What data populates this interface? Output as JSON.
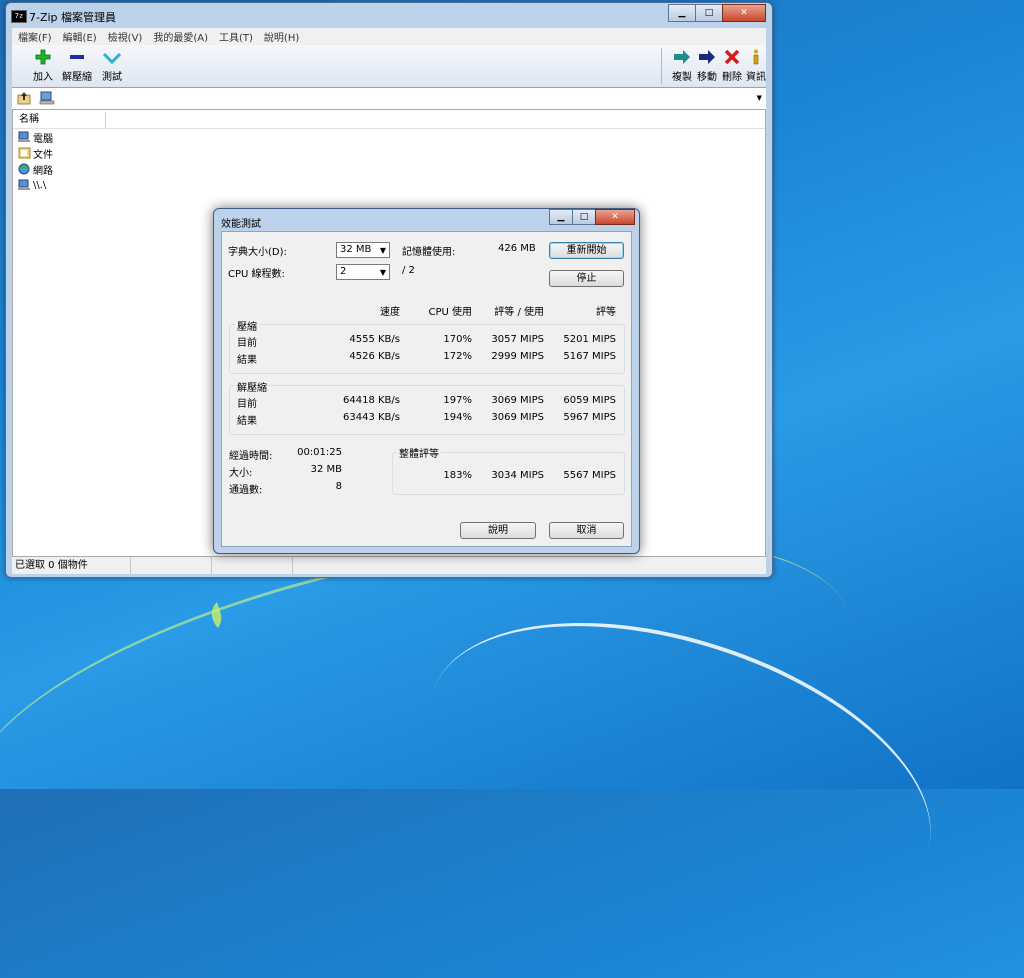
{
  "window": {
    "app_icon": "7z",
    "title": "7-Zip 檔案管理員",
    "menu": [
      "檔案(F)",
      "編輯(E)",
      "檢視(V)",
      "我的最愛(A)",
      "工具(T)",
      "說明(H)"
    ],
    "toolbar_left": [
      {
        "label": "加入",
        "icon": "plus-icon"
      },
      {
        "label": "解壓縮",
        "icon": "minus-icon"
      },
      {
        "label": "測試",
        "icon": "check-icon"
      }
    ],
    "toolbar_right": [
      {
        "label": "複製",
        "icon": "copy-arrow-icon"
      },
      {
        "label": "移動",
        "icon": "move-arrow-icon"
      },
      {
        "label": "刪除",
        "icon": "delete-x-icon"
      },
      {
        "label": "資訊",
        "icon": "info-icon"
      }
    ],
    "column_name": "名稱",
    "items": [
      "電腦",
      "文件",
      "網路",
      "\\\\.\\"
    ],
    "status": "已選取 0 個物件"
  },
  "dialog": {
    "title": "效能測試",
    "dict_label": "字典大小(D):",
    "dict_value": "32 MB",
    "memory_label": "記憶體使用:",
    "memory_value": "426 MB",
    "threads_label": "CPU 線程數:",
    "threads_value": "2",
    "threads_total": "/ 2",
    "restart_button": "重新開始",
    "stop_button": "停止",
    "headers": {
      "speed": "速度",
      "cpu": "CPU 使用",
      "rating_usage": "評等 / 使用",
      "rating": "評等"
    },
    "compress": {
      "label": "壓縮",
      "current": {
        "label": "目前",
        "speed": "4555 KB/s",
        "cpu": "170%",
        "rating_usage": "3057 MIPS",
        "rating": "5201 MIPS"
      },
      "result": {
        "label": "結果",
        "speed": "4526 KB/s",
        "cpu": "172%",
        "rating_usage": "2999 MIPS",
        "rating": "5167 MIPS"
      }
    },
    "decompress": {
      "label": "解壓縮",
      "current": {
        "label": "目前",
        "speed": "64418 KB/s",
        "cpu": "197%",
        "rating_usage": "3069 MIPS",
        "rating": "6059 MIPS"
      },
      "result": {
        "label": "結果",
        "speed": "63443 KB/s",
        "cpu": "194%",
        "rating_usage": "3069 MIPS",
        "rating": "5967 MIPS"
      }
    },
    "elapsed_label": "經過時間:",
    "elapsed_value": "00:01:25",
    "size_label": "大小:",
    "size_value": "32 MB",
    "passes_label": "通過數:",
    "passes_value": "8",
    "total_label": "整體評等",
    "total_cpu": "183%",
    "total_rating_usage": "3034 MIPS",
    "total_rating": "5567 MIPS",
    "help_button": "說明",
    "cancel_button": "取消"
  }
}
